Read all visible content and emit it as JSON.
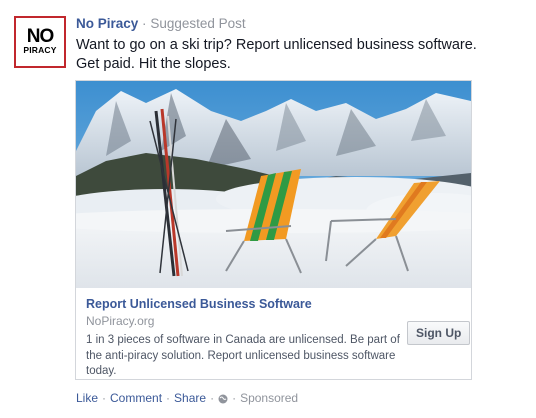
{
  "post": {
    "page_name": "No Piracy",
    "separator": "·",
    "suggested_label": "Suggested Post",
    "text_line1": "Want to go on a ski trip? Report unlicensed business software.",
    "text_line2": "Get paid. Hit the slopes."
  },
  "avatar": {
    "line1": "NO",
    "line2": "PIRACY"
  },
  "ad": {
    "title": "Report Unlicensed Business Software",
    "domain": "NoPiracy.org",
    "description": "1 in 3 pieces of software in Canada are unlicensed. Be part of the anti-piracy solution. Report unlicensed business software today.",
    "cta_label": "Sign Up"
  },
  "footer": {
    "like": "Like",
    "comment": "Comment",
    "share": "Share",
    "sponsored": "Sponsored",
    "separator": "·"
  },
  "colors": {
    "link_blue": "#3b5998",
    "muted_gray": "#90949c",
    "brand_red": "#c1272d"
  },
  "icons": {
    "privacy": "globe-icon",
    "image": "ski-mountain-photo"
  }
}
